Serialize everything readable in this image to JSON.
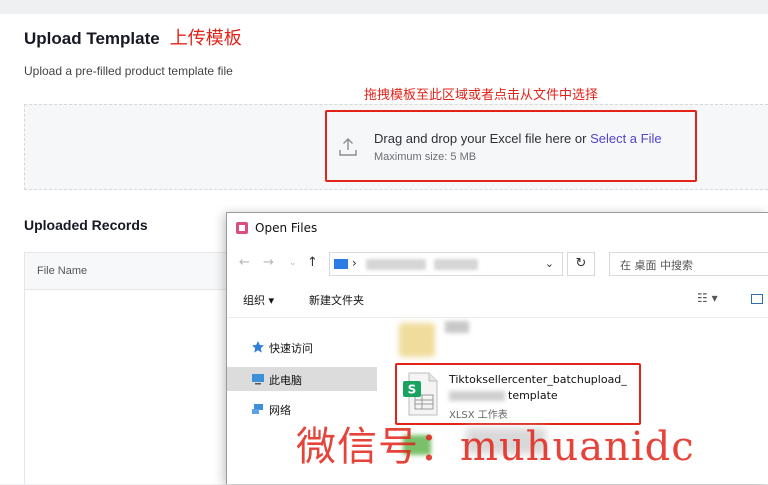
{
  "page": {
    "title": "Upload Template",
    "title_annotation": "上传模板",
    "subtitle": "Upload a pre-filled product template file",
    "hint_annotation": "拖拽模板至此区域或者点击从文件中选择"
  },
  "dropzone": {
    "text": "Drag and drop your Excel file here or ",
    "link": "Select a File",
    "max_size": "Maximum size: 5 MB",
    "icon": "upload-icon"
  },
  "records": {
    "title": "Uploaded Records",
    "columns": [
      "File Name"
    ]
  },
  "dialog": {
    "title": "Open Files",
    "address_separator": "›",
    "search_placeholder": "在 桌面 中搜索",
    "toolbar": {
      "organize": "组织 ▾",
      "new_folder": "新建文件夹"
    },
    "nav_items": [
      {
        "label": "快速访问",
        "icon": "pin-icon"
      },
      {
        "label": "此电脑",
        "icon": "computer-icon"
      },
      {
        "label": "网络",
        "icon": "network-icon"
      }
    ],
    "file": {
      "name_line1": "Tiktoksellercenter_batchupload_",
      "name_line2": "template",
      "type": "XLSX 工作表"
    }
  },
  "watermark": "微信号：muhuanidc",
  "colors": {
    "annotation_red": "#e2231a",
    "link_purple": "#4f46c8"
  }
}
